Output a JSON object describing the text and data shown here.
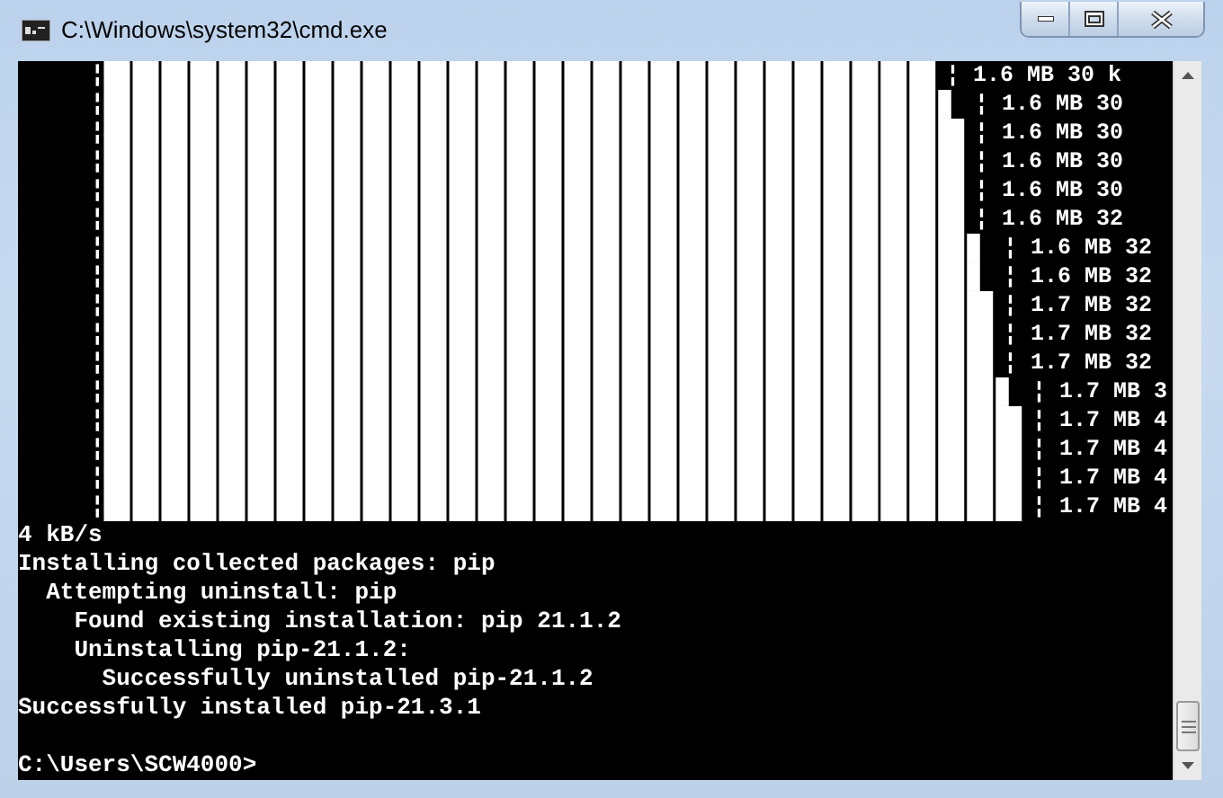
{
  "window": {
    "title": "C:\\Windows\\system32\\cmd.exe"
  },
  "progress_rows": [
    {
      "marker": "¦",
      "bar": "█████████████████████████████",
      "reading": "¦ 1.6 MB 30 k"
    },
    {
      "marker": "¦",
      "bar": "█████████████████████████████▌",
      "reading": "¦ 1.6 MB 30"
    },
    {
      "marker": "¦",
      "bar": "██████████████████████████████",
      "reading": "¦ 1.6 MB 30"
    },
    {
      "marker": "¦",
      "bar": "██████████████████████████████",
      "reading": "¦ 1.6 MB 30"
    },
    {
      "marker": "¦",
      "bar": "██████████████████████████████",
      "reading": "¦ 1.6 MB 30"
    },
    {
      "marker": "¦",
      "bar": "██████████████████████████████",
      "reading": "¦ 1.6 MB 32"
    },
    {
      "marker": "¦",
      "bar": "██████████████████████████████▌",
      "reading": "¦ 1.6 MB 32"
    },
    {
      "marker": "¦",
      "bar": "██████████████████████████████▌",
      "reading": "¦ 1.6 MB 32"
    },
    {
      "marker": "¦",
      "bar": "███████████████████████████████",
      "reading": "¦ 1.7 MB 32"
    },
    {
      "marker": "¦",
      "bar": "███████████████████████████████",
      "reading": "¦ 1.7 MB 32"
    },
    {
      "marker": "¦",
      "bar": "███████████████████████████████",
      "reading": "¦ 1.7 MB 32"
    },
    {
      "marker": "¦",
      "bar": "███████████████████████████████▌",
      "reading": "¦ 1.7 MB 3"
    },
    {
      "marker": "¦",
      "bar": "████████████████████████████████",
      "reading": "¦ 1.7 MB 4"
    },
    {
      "marker": "¦",
      "bar": "████████████████████████████████",
      "reading": "¦ 1.7 MB 4"
    },
    {
      "marker": "¦",
      "bar": "████████████████████████████████",
      "reading": "¦ 1.7 MB 4"
    },
    {
      "marker": "¦",
      "bar": "████████████████████████████████",
      "reading": "¦ 1.7 MB 4"
    }
  ],
  "output_lines": [
    "4 kB/s",
    "Installing collected packages: pip",
    "  Attempting uninstall: pip",
    "    Found existing installation: pip 21.1.2",
    "    Uninstalling pip-21.1.2:",
    "      Successfully uninstalled pip-21.1.2",
    "Successfully installed pip-21.3.1"
  ],
  "prompt": "C:\\Users\\SCW4000>"
}
